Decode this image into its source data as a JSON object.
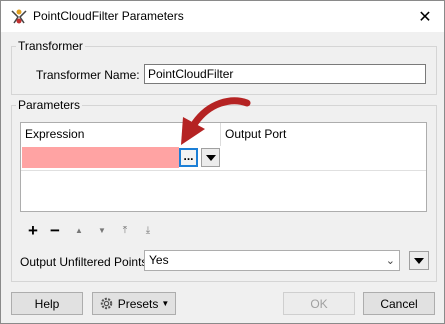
{
  "window": {
    "title": "PointCloudFilter Parameters",
    "close_glyph": "✕",
    "app_icon": "fme-transformer-icon"
  },
  "transformer_group": {
    "legend": "Transformer",
    "name_label": "Transformer Name:",
    "name_value": "PointCloudFilter"
  },
  "parameters_group": {
    "legend": "Parameters",
    "table": {
      "columns": [
        "Expression",
        "Output Port"
      ],
      "rows": [
        {
          "expression": "",
          "output_port": ""
        }
      ],
      "ellipsis_label": "...",
      "invalid_color": "#ffa3a3",
      "annotation_arrow_color": "#b52323"
    },
    "toolbar": {
      "add": "+",
      "remove": "−",
      "move_up": "▲",
      "move_down": "▼",
      "move_top": "⤒",
      "move_bottom": "⤓"
    },
    "unfiltered_label": "Output Unfiltered Points:",
    "unfiltered_value": "Yes"
  },
  "buttons": {
    "help": "Help",
    "presets": "Presets",
    "ok": "OK",
    "cancel": "Cancel"
  }
}
